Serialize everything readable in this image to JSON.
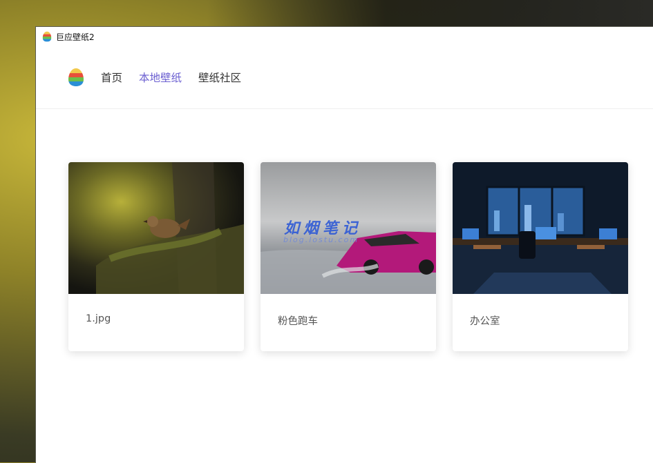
{
  "window": {
    "title": "巨应壁纸2"
  },
  "nav": {
    "items": [
      {
        "label": "首页",
        "active": false
      },
      {
        "label": "本地壁纸",
        "active": true
      },
      {
        "label": "壁纸社区",
        "active": false
      }
    ]
  },
  "wallpapers": [
    {
      "title": "1.jpg",
      "image": "bird-on-mossy-log"
    },
    {
      "title": "粉色跑车",
      "image": "pink-sports-car-in-snow",
      "watermark": "如烟笔记",
      "watermark_sub": "blog.lostu.com"
    },
    {
      "title": "办公室",
      "image": "night-office-city-view"
    }
  ],
  "colors": {
    "accent": "#6b5fd1"
  }
}
